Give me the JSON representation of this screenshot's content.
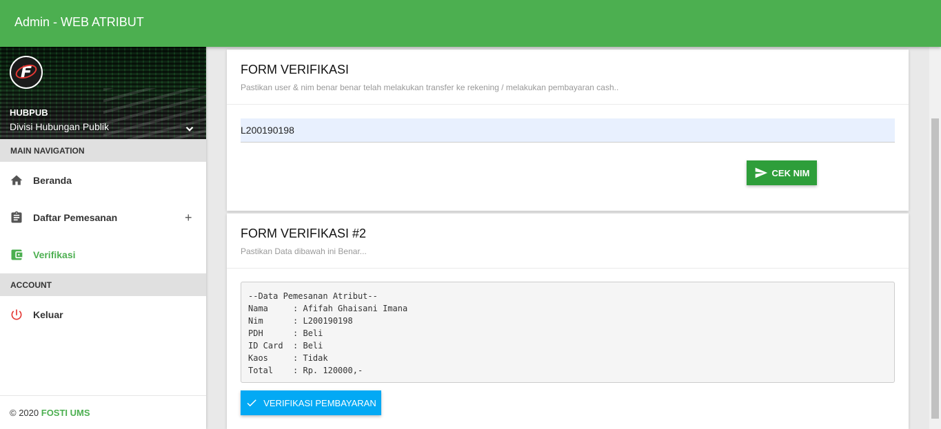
{
  "app": {
    "title": "Admin - WEB ATRIBUT"
  },
  "user": {
    "name": "HUBPUB",
    "role": "Divisi Hubungan Publik"
  },
  "sidebar": {
    "main_header": "MAIN NAVIGATION",
    "items": [
      {
        "label": "Beranda",
        "icon": "home-icon"
      },
      {
        "label": "Daftar Pemesanan",
        "icon": "clipboard-icon",
        "expand": "+"
      },
      {
        "label": "Verifikasi",
        "icon": "wallet-icon",
        "active": true
      }
    ],
    "account_header": "ACCOUNT",
    "account_items": [
      {
        "label": "Keluar",
        "icon": "power-icon"
      }
    ],
    "footer": {
      "copyright": "© 2020",
      "brand": "FOSTI UMS"
    }
  },
  "form1": {
    "title": "FORM VERIFIKASI",
    "subtitle": "Pastikan user & nim benar benar telah melakukan transfer ke rekening / melakukan pembayaran cash..",
    "nim_value": "L200190198",
    "button_label": "CEK NIM"
  },
  "form2": {
    "title": "FORM VERIFIKASI #2",
    "subtitle": "Pastikan Data dibawah ini Benar...",
    "data_text": "--Data Pemesanan Atribut--\nNama     : Afifah Ghaisani Imana\nNim      : L200190198\nPDH      : Beli\nID Card  : Beli\nKaos     : Tidak\nTotal    : Rp. 120000,-",
    "button_label": "VERIFIKASI PEMBAYARAN"
  },
  "colors": {
    "primary": "#4caf50",
    "cek_button": "#2e9e3a",
    "verify_button": "#03a9f4",
    "logout_icon": "#e53935"
  }
}
